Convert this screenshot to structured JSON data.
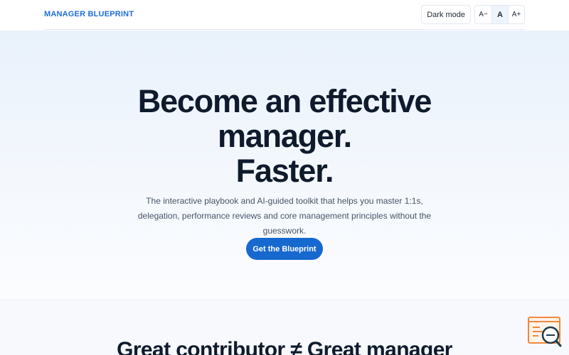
{
  "header": {
    "logo": "MANAGER BLUEPRINT",
    "dark_mode_label": "Dark mode",
    "font_sizes": {
      "decrease": "A−",
      "normal": "A",
      "increase": "A+"
    },
    "active_font_size": "normal"
  },
  "hero": {
    "title_line1": "Become an effective",
    "title_line2": "manager.",
    "title_line3": "Faster.",
    "subtitle": "The interactive playbook and AI-guided toolkit that helps you master 1:1s, delegation, performance reviews and core management principles without the guesswork.",
    "cta_label": "Get the Blueprint"
  },
  "section2": {
    "title": "Great contributor ≠ Great manager"
  },
  "widget": {
    "icon": "feedback-search-icon"
  },
  "colors": {
    "brand": "#1e6fd9",
    "cta": "#1768cf",
    "heading": "#0f1b2d",
    "widget_accent": "#f0883e"
  }
}
